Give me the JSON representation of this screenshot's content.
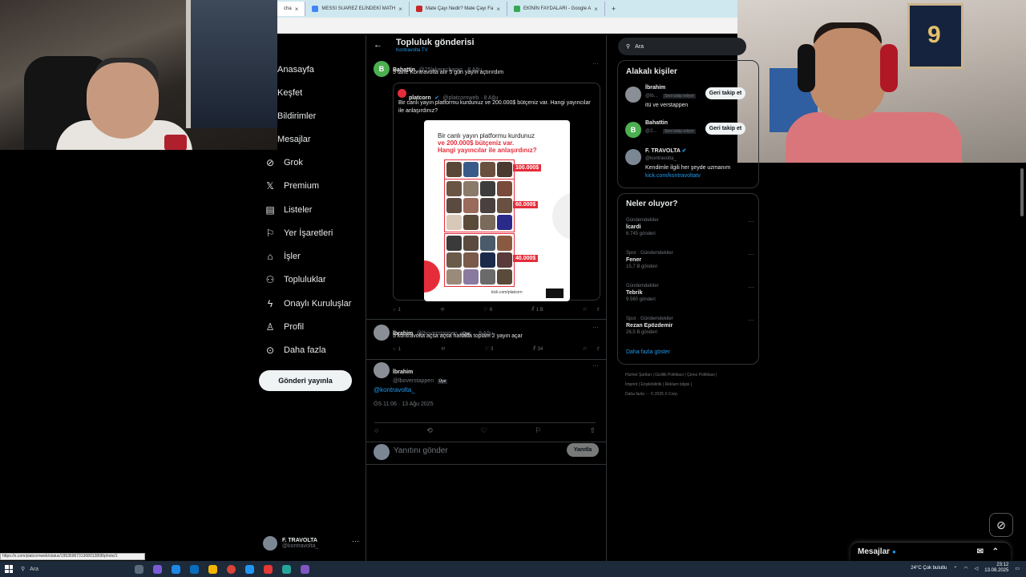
{
  "browser": {
    "tabs": [
      {
        "label": "cha",
        "color": "#1da1f2",
        "active": true
      },
      {
        "label": "MESSI SUAREZ ELİNDEKİ MATH",
        "color": "#4285f4"
      },
      {
        "label": "Mate Çayı Nedir? Mate Çayı Fa",
        "color": "#c62828"
      },
      {
        "label": "EKİNİN FAYDALARI - Google A",
        "color": "#34a853"
      }
    ],
    "new_tab": "+",
    "close": "×"
  },
  "nav": {
    "items": [
      {
        "label": "Anasayfa",
        "icon": "home-icon",
        "glyph": ""
      },
      {
        "label": "Keşfet",
        "icon": "search-icon",
        "glyph": ""
      },
      {
        "label": "Bildirimler",
        "icon": "bell-icon",
        "glyph": ""
      },
      {
        "label": "Mesajlar",
        "icon": "mail-icon",
        "glyph": ""
      },
      {
        "label": "Grok",
        "icon": "grok-icon",
        "glyph": "⊘"
      },
      {
        "label": "Premium",
        "icon": "x-logo-icon",
        "glyph": "𝕏"
      },
      {
        "label": "Listeler",
        "icon": "list-icon",
        "glyph": "▤"
      },
      {
        "label": "Yer İşaretleri",
        "icon": "bookmark-icon",
        "glyph": "⚐"
      },
      {
        "label": "İşler",
        "icon": "briefcase-icon",
        "glyph": "⌂"
      },
      {
        "label": "Topluluklar",
        "icon": "communities-icon",
        "glyph": "⚇"
      },
      {
        "label": "Onaylı Kuruluşlar",
        "icon": "lightning-icon",
        "glyph": "ϟ"
      },
      {
        "label": "Profil",
        "icon": "person-icon",
        "glyph": "♙"
      },
      {
        "label": "Daha fazla",
        "icon": "more-circle-icon",
        "glyph": "⊙"
      }
    ],
    "post_button": "Gönderi yayınla",
    "account": {
      "name": "F. TRAVOLTA",
      "handle": "@kontravolta_",
      "more": "···"
    }
  },
  "main": {
    "back": "←",
    "title": "Topluluk gönderisi",
    "subtitle": "Kontravolta TV",
    "post1": {
      "avatar_letter": "B",
      "name": "Bahattin",
      "handle": "@25lakerschamp · 8 Ağu",
      "text": "5 tane Kontravolta alır 5 gün yayın açtırırdım",
      "quote": {
        "name": "platcorn",
        "handle": "@platcornweb · 8 Ağu",
        "text": "Bir canlı yayın platformu kurdunuz ve 200.000$ bütçeniz var. Hangi yayıncılar ile anlaşırdınız?",
        "image": {
          "line1": "Bir canlı yayın platformu kurdunuz",
          "line2": "ve 200.000$ bütçeniz var.",
          "line3": "Hangi yayıncılar ile anlaşırdınız?",
          "prices": [
            "100.000$",
            "60.000$",
            "40.000$"
          ],
          "site": "kick.com/platcorn"
        }
      },
      "stats": {
        "reply": "1",
        "repost": "",
        "like": "6",
        "views": "1 B"
      }
    },
    "post2": {
      "name": "İbrahim",
      "handle": "@lboverstappen",
      "badge": "Üye",
      "time": "· 8 Ağu",
      "text": "5 kontravolta açsa açsa haftada toplam 2 yayın açar",
      "stats": {
        "reply": "1",
        "repost": "",
        "like": "3",
        "views": "34"
      }
    },
    "post3": {
      "name": "İbrahim",
      "handle": "@lboverstappen",
      "badge": "Üye",
      "mention": "@kontravolta_",
      "date": "ÖS 11:06 · 13 Ağu 2025"
    },
    "reply": {
      "placeholder": "Yanıtını gönder",
      "button": "Yanıtla"
    }
  },
  "sidebar": {
    "search_placeholder": "Ara",
    "related_title": "Alakalı kişiler",
    "related": [
      {
        "name": "İbrahim",
        "handle": "@lb...",
        "follows": "Seni takip ediyor",
        "bio": "itü ve verstappen",
        "button": "Geri takip et"
      },
      {
        "name": "Bahattin",
        "handle": "@2...",
        "follows": "Seni takip ediyor",
        "bio": "",
        "button": "Geri takip et",
        "avatar_letter": "B"
      },
      {
        "name": "F. TRAVOLTA",
        "handle": "@kontravolta_",
        "bio": "Kendimle ilgili her şeyde uzmanım",
        "link": "kick.com/kontravoltatv"
      }
    ],
    "trends_title": "Neler oluyor?",
    "trends": [
      {
        "category": "Gündemdekiler",
        "title": "İcardi",
        "count": "6.745 gönderi"
      },
      {
        "category": "Spor · Gündemdekiler",
        "title": "Fener",
        "count": "15,7 B gönderi"
      },
      {
        "category": "Gündemdekiler",
        "title": "Tebrik",
        "count": "9.560 gönderi"
      },
      {
        "category": "Spor · Gündemdekiler",
        "title": "Rezan Epözdemir",
        "count": "26,5 B gönderi"
      }
    ],
    "show_more": "Daha fazla göster",
    "footer_links": [
      "Hizmet Şartları",
      "Gizlilik Politikası",
      "Çerez Politikası",
      "İmprint",
      "Erişilebilirlik",
      "Reklam bilgisi",
      "Daha fazla ···",
      "© 2025 X Corp."
    ]
  },
  "messages_bar": {
    "label": "Mesajlar"
  },
  "status_url": "https://x.com/platcornweb/status/1953696731308012808/photo/1",
  "taskbar": {
    "search": "Ara",
    "weather": "24°C  Çok bulutlu",
    "time": "23:12",
    "date": "13.08.2025"
  },
  "colors": {
    "accent": "#1d9bf0",
    "brand_red": "#e52d3a"
  }
}
